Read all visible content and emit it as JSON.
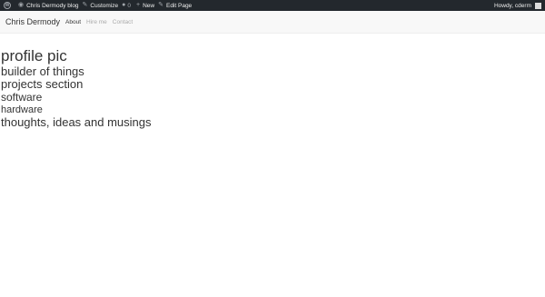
{
  "admin_bar": {
    "site_name": "Chris Dermody blog",
    "customize": "Customize",
    "comments_count": "0",
    "new_label": "New",
    "edit_page": "Edit Page",
    "greeting": "Howdy, cderm"
  },
  "navbar": {
    "brand": "Chris Dermody",
    "links": [
      "About",
      "Hire me",
      "Contact"
    ]
  },
  "content": {
    "lines": [
      "profile pic",
      "builder of things",
      "projects section",
      "software",
      "hardware",
      "thoughts, ideas and musings"
    ]
  }
}
